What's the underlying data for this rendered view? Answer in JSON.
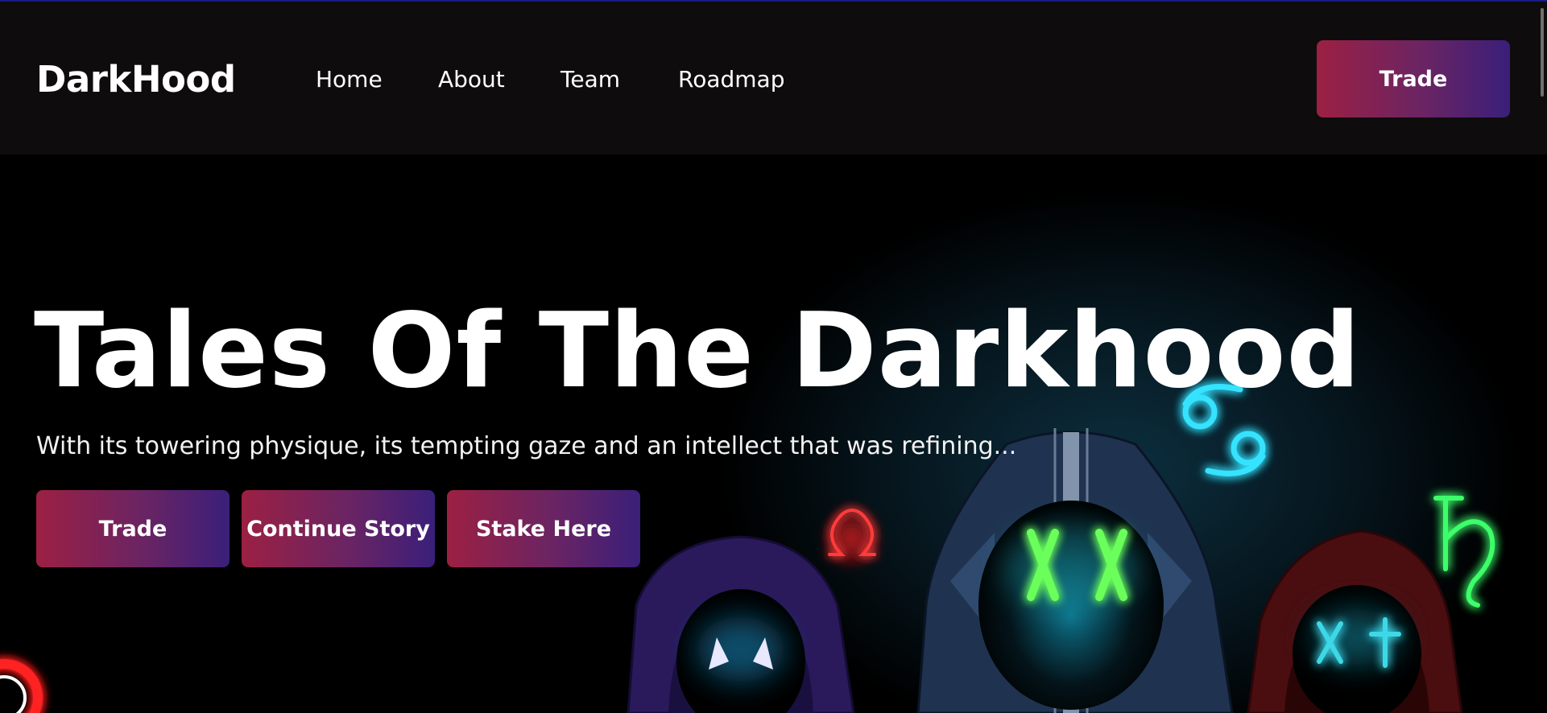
{
  "nav": {
    "logo": "DarkHood",
    "links": [
      "Home",
      "About",
      "Team",
      "Roadmap"
    ],
    "trade_button": "Trade"
  },
  "hero": {
    "title": "Tales Of The Darkhood",
    "subtitle": "With its towering physique, its tempting gaze and an intellect that was refining...",
    "buttons": [
      "Trade",
      "Continue Story",
      "Stake Here"
    ]
  },
  "colors": {
    "gradient_start": "#9c2043",
    "gradient_end": "#3a1f7a",
    "navbar_bg": "#0e0c0d",
    "neon_cyan": "#35e3ff",
    "neon_green": "#3dff6a",
    "neon_red": "#ff2d3d"
  },
  "icons": [
    "cancer-symbol-icon",
    "omega-symbol-icon",
    "saturn-symbol-icon"
  ]
}
